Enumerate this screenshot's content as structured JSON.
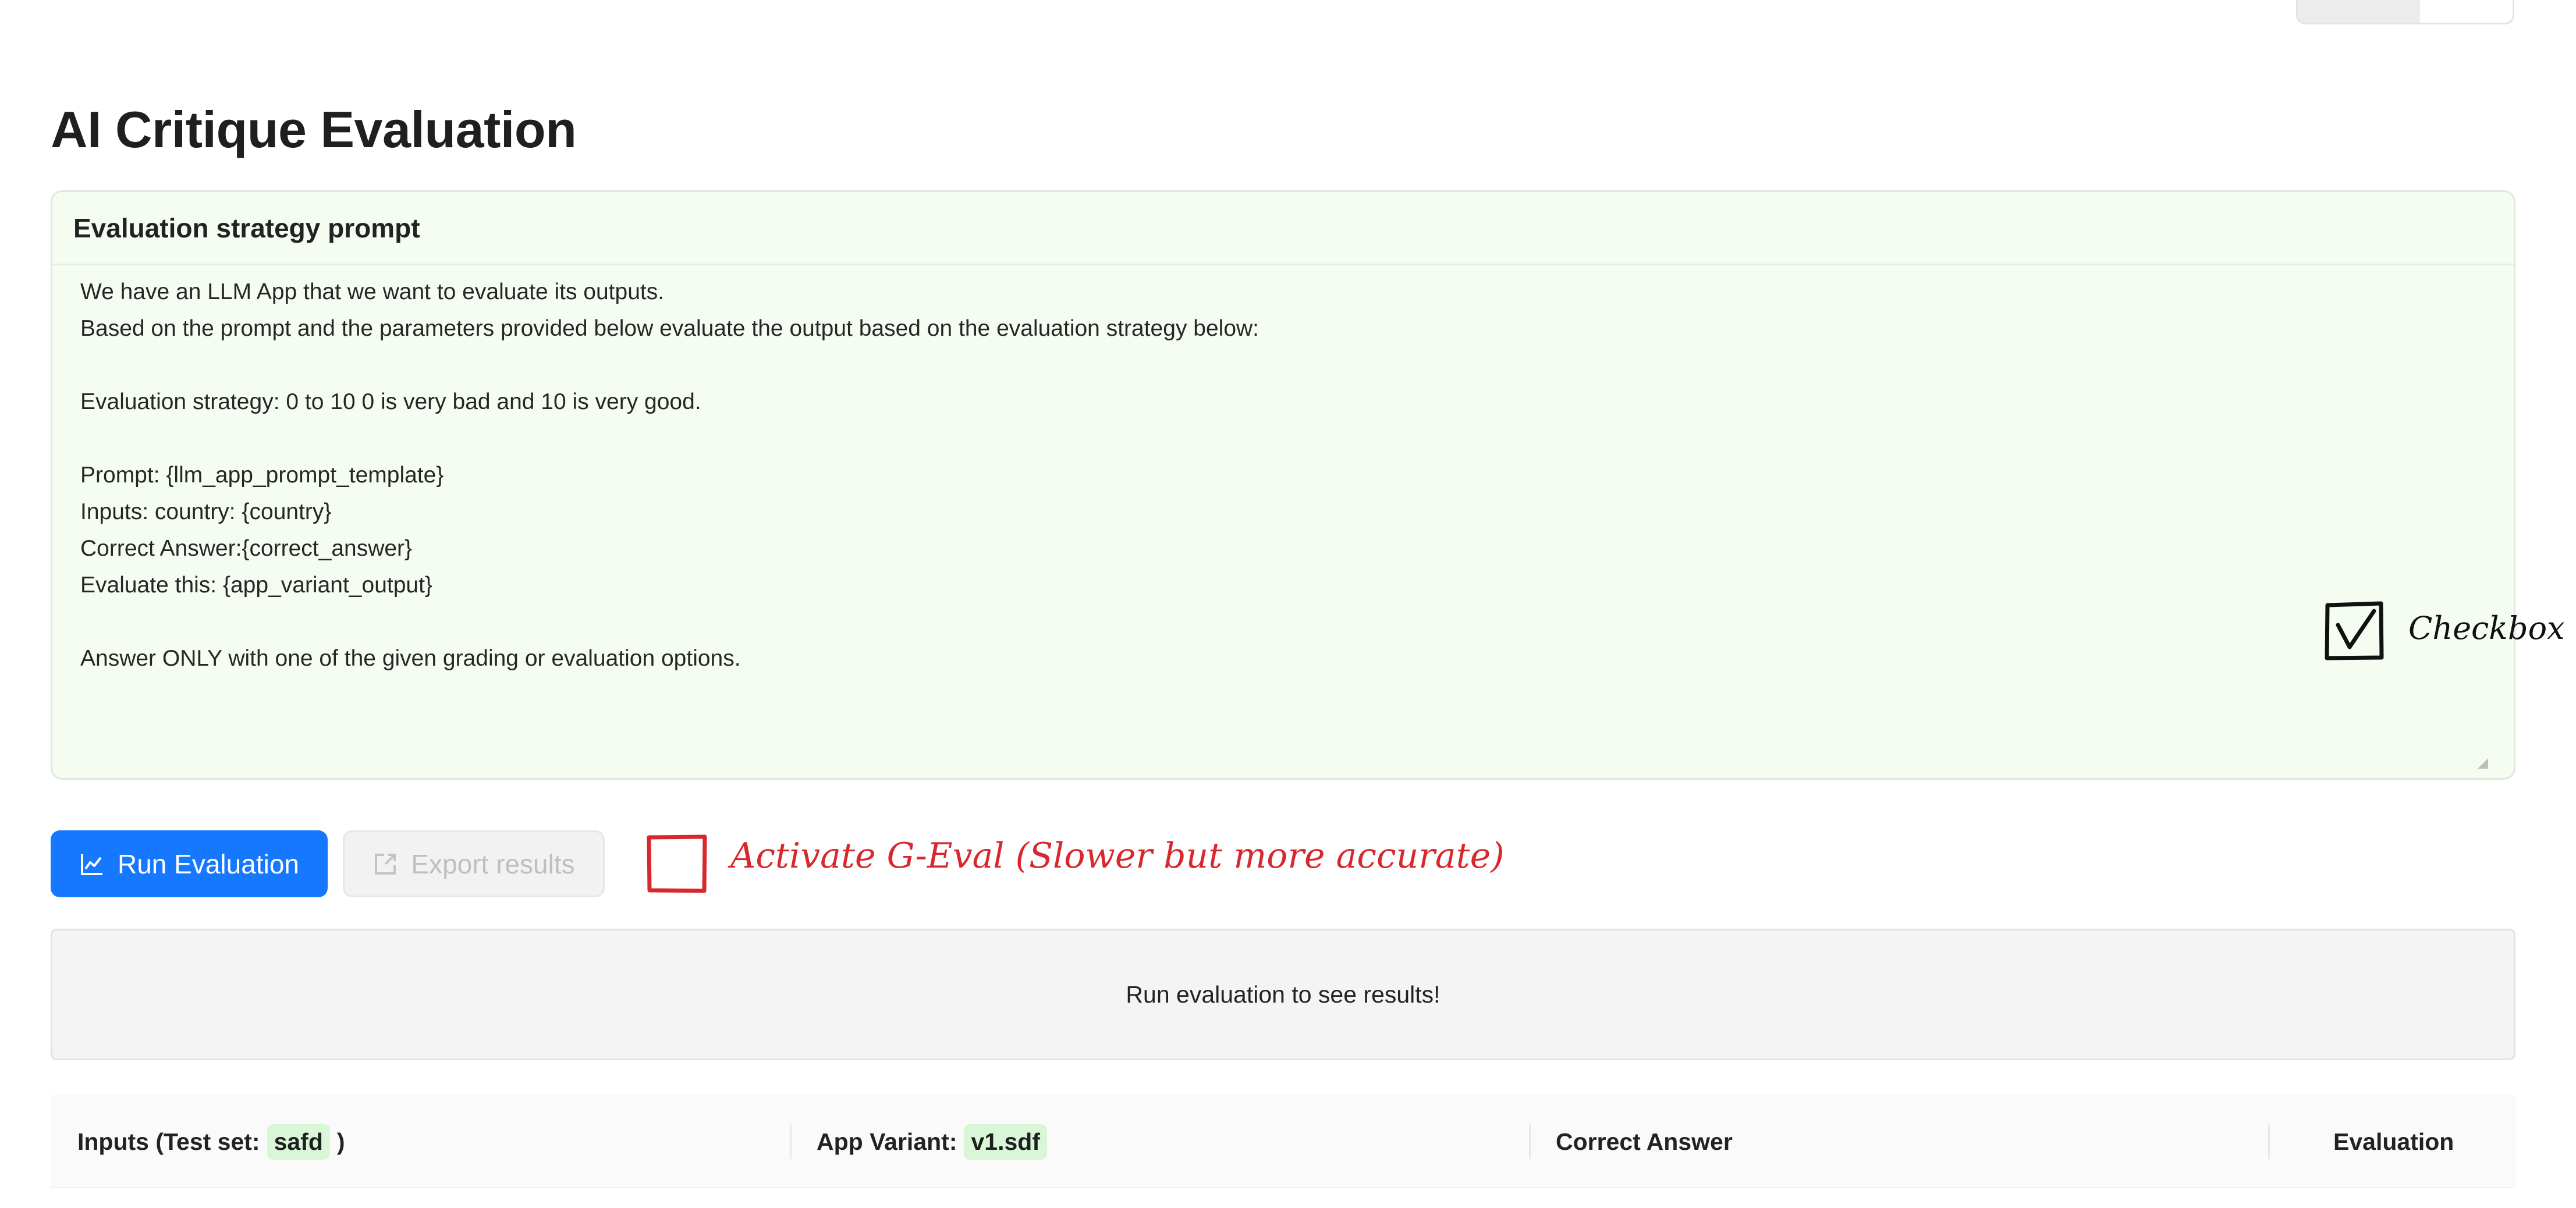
{
  "page": {
    "title": "AI Critique Evaluation"
  },
  "prompt_card": {
    "title": "Evaluation strategy prompt",
    "lines": [
      "We have an LLM App that we want to evaluate its outputs.",
      "Based on the prompt and the parameters provided below evaluate the output based on the evaluation strategy below:",
      "",
      "Evaluation strategy: 0 to 10 0 is very bad and 10 is very good.",
      "",
      "Prompt: {llm_app_prompt_template}",
      "Inputs: country: {country}",
      "Correct Answer:{correct_answer}",
      "Evaluate this: {app_variant_output}",
      "",
      "Answer ONLY with one of the given grading or evaluation options."
    ]
  },
  "annotation": {
    "checkbox_label": "Checkbox",
    "geval_label": "Activate G-Eval (Slower but more accurate)",
    "geval_color": "#d9272e"
  },
  "actions": {
    "run_label": "Run Evaluation",
    "run_icon": "line-chart-icon",
    "export_label": "Export results",
    "export_icon": "export-icon",
    "primary_color": "#1677ff"
  },
  "results": {
    "empty_message": "Run evaluation to see results!"
  },
  "table": {
    "inputs_label": "Inputs (Test set:",
    "inputs_tag": "safd",
    "inputs_suffix": ")",
    "variant_label": "App Variant:",
    "variant_tag": "v1.sdf",
    "correct_answer_label": "Correct Answer",
    "evaluation_label": "Evaluation",
    "tag_color": "#d9f7d6"
  }
}
